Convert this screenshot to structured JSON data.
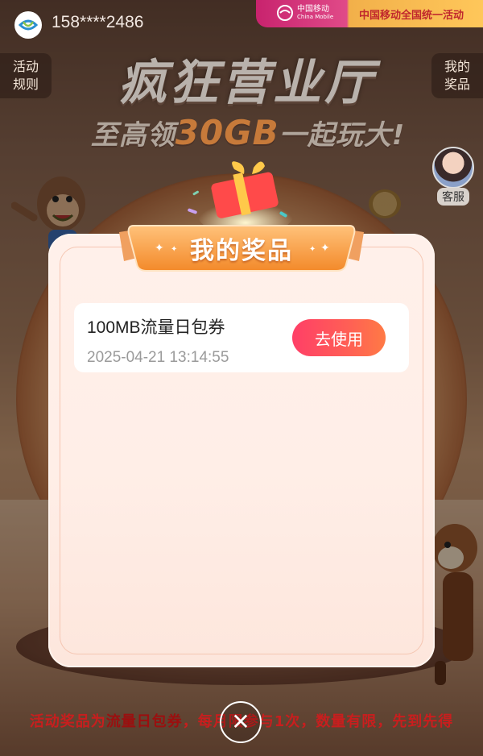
{
  "header": {
    "phone": "158****2486",
    "brand_cn": "中国移动",
    "brand_en": "China Mobile",
    "slogan": "中国移动全国统一活动"
  },
  "side": {
    "rules_line1": "活动",
    "rules_line2": "规则",
    "prizes_line1": "我的",
    "prizes_line2": "奖品",
    "service": "客服"
  },
  "hero": {
    "title": "疯狂营业厅",
    "sub_prefix": "至高领",
    "sub_highlight": "30GB",
    "sub_suffix": "一起玩大!"
  },
  "modal": {
    "title": "我的奖品",
    "prizes": [
      {
        "name": "100MB流量日包券",
        "time": "2025-04-21 13:14:55",
        "action": "去使用"
      }
    ]
  },
  "footer": {
    "text_a": "活动奖品为",
    "text_hl": "流量日包券",
    "text_b": "，每月限参与1次，数量有限，先到先得"
  },
  "colors": {
    "accent": "#ff4a62",
    "ribbon": "#f7a24a",
    "brand": "#c8236e"
  }
}
